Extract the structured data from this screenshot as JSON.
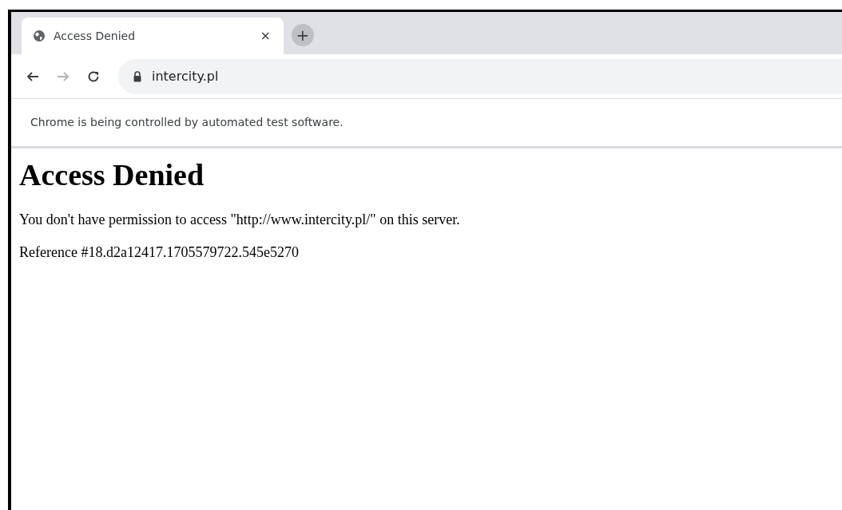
{
  "tabs": [
    {
      "title": "Access Denied",
      "close": "×",
      "selected": true
    }
  ],
  "new_tab": "+",
  "toolbar": {
    "back_disabled": false,
    "forward_disabled": true
  },
  "address_bar": {
    "url": "intercity.pl",
    "secure": true
  },
  "infobar": "Chrome is being controlled by automated test software.",
  "page": {
    "heading": "Access Denied",
    "paragraphs": [
      "You don't have permission to access \"http://www.intercity.pl/\" on this server.",
      "Reference #18.d2a12417.1705579722.545e5270"
    ]
  }
}
